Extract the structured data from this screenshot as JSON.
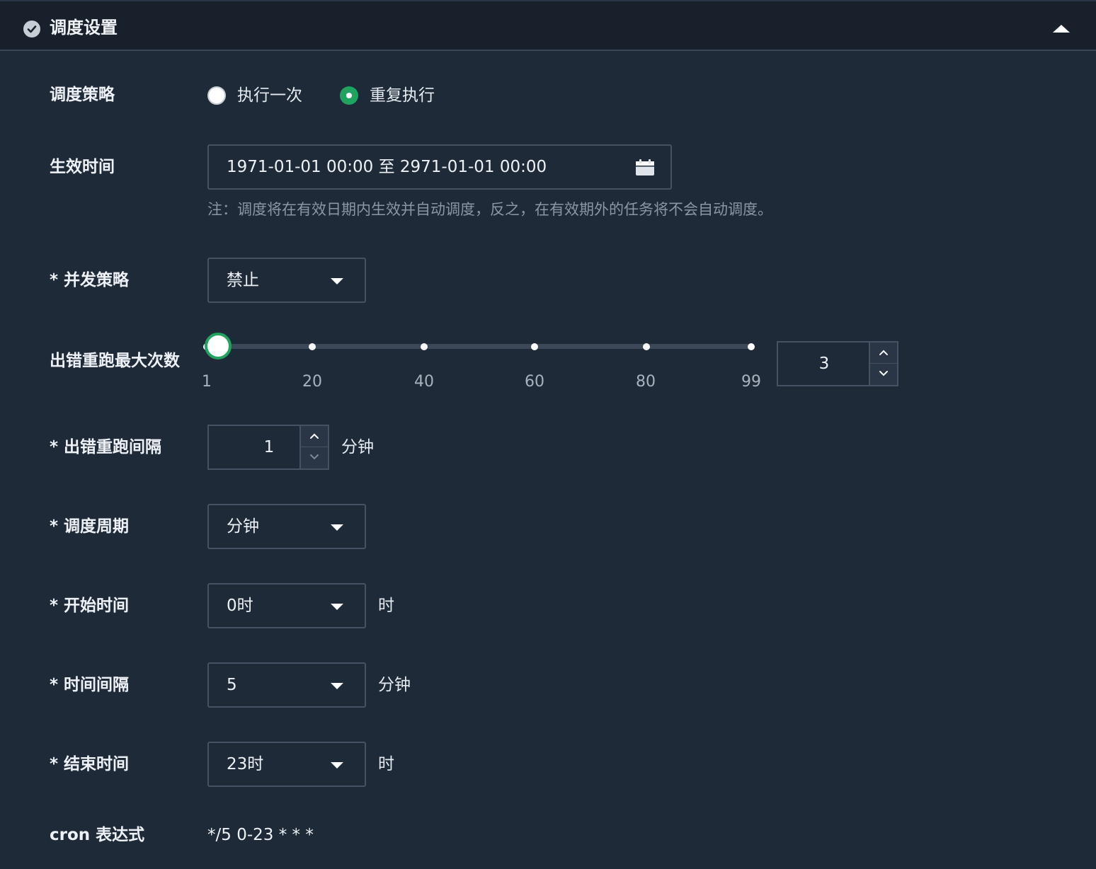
{
  "header": {
    "title": "调度设置",
    "status_icon": "check-circle-icon",
    "collapse_icon": "caret-up-icon"
  },
  "schedule_strategy": {
    "label": "调度策略",
    "options": [
      "执行一次",
      "重复执行"
    ],
    "selected": "重复执行"
  },
  "effective_time": {
    "label": "生效时间",
    "value": "1971-01-01 00:00 至 2971-01-01 00:00",
    "icon": "calendar-icon",
    "note": "注：调度将在有效日期内生效并自动调度，反之，在有效期外的任务将不会自动调度。"
  },
  "concurrency": {
    "label": "* 并发策略",
    "value": "禁止"
  },
  "max_retries": {
    "label": "出错重跑最大次数",
    "slider_min": 1,
    "slider_max": 99,
    "slider_value": 3,
    "ticks": [
      "1",
      "20",
      "40",
      "60",
      "80",
      "99"
    ],
    "input_value": "3"
  },
  "retry_interval": {
    "label": "* 出错重跑间隔",
    "value": "1",
    "unit": "分钟"
  },
  "period": {
    "label": "* 调度周期",
    "value": "分钟"
  },
  "start_time": {
    "label": "* 开始时间",
    "value": "0时",
    "unit": "时"
  },
  "interval": {
    "label": "* 时间间隔",
    "value": "5",
    "unit": "分钟"
  },
  "end_time": {
    "label": "* 结束时间",
    "value": "23时",
    "unit": "时"
  },
  "cron": {
    "label": "cron 表达式",
    "value": "*/5 0-23 * * *"
  },
  "colors": {
    "accent": "#1fa35f",
    "background": "#1f2a38",
    "header": "#18202c",
    "border": "#465263",
    "muted_text": "#8c96a3"
  }
}
